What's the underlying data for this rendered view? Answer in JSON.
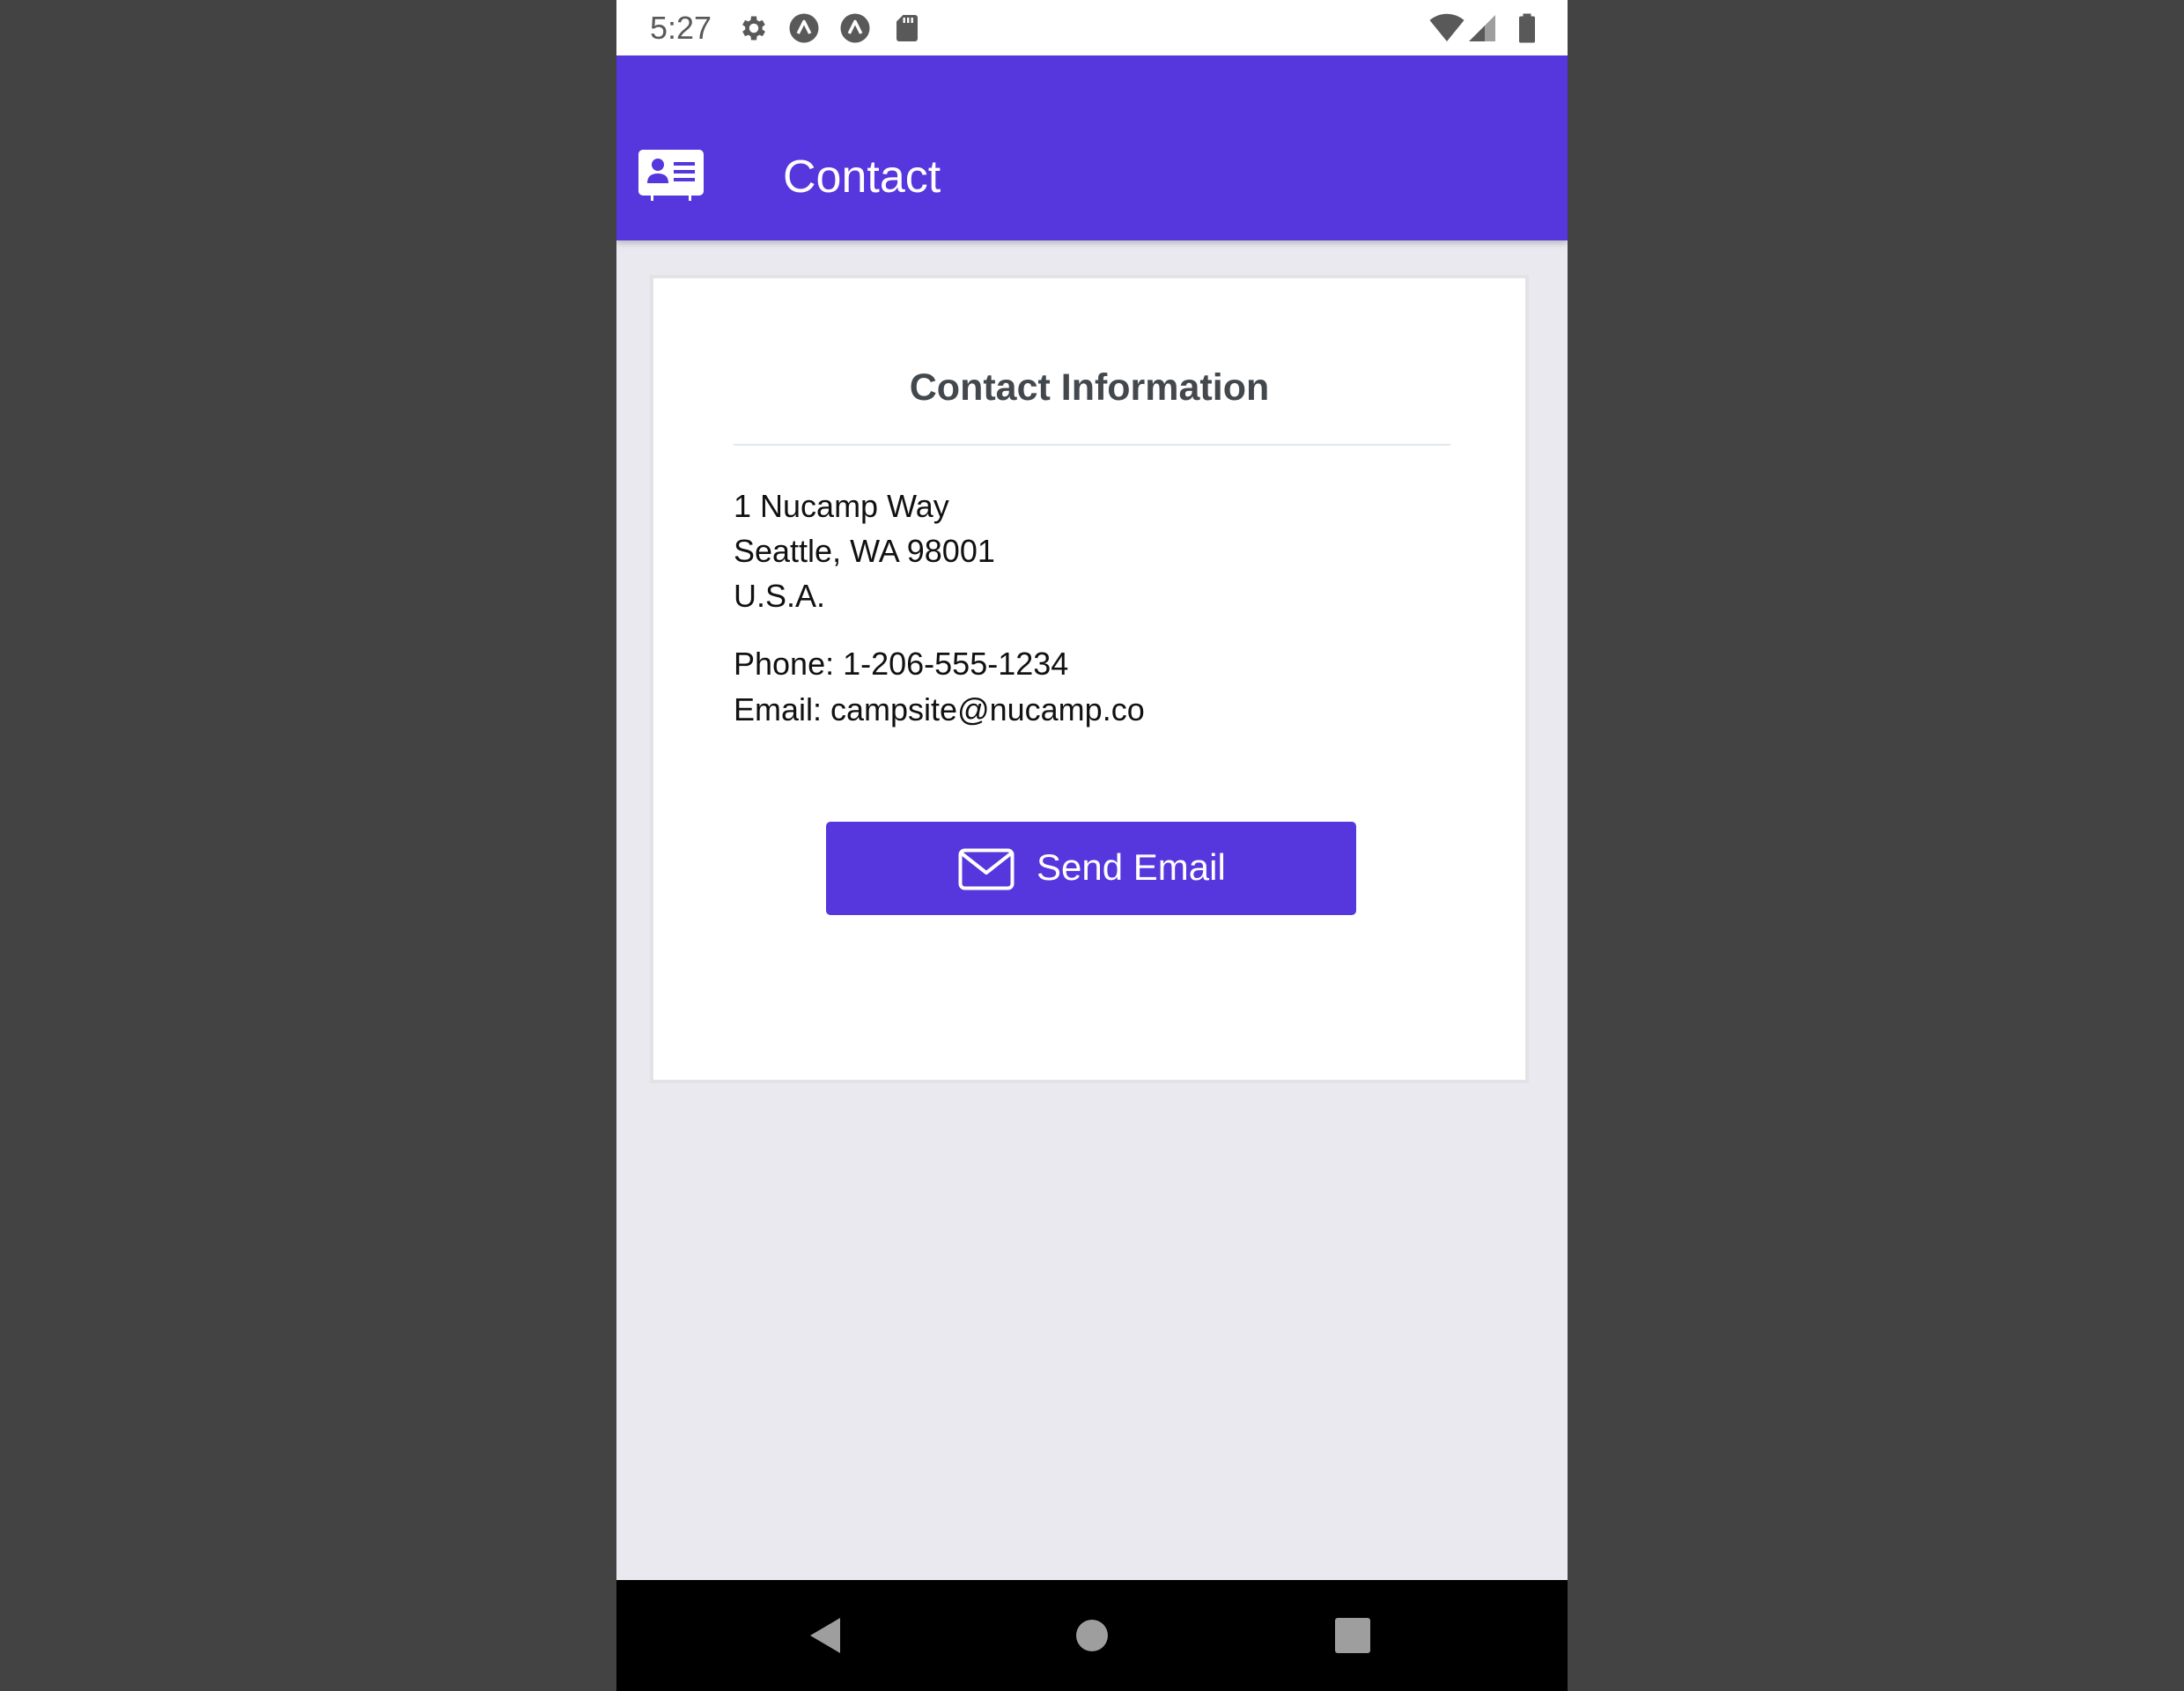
{
  "status_bar": {
    "time": "5:27",
    "icons_left": [
      "settings-icon",
      "app-notification-icon",
      "app-notification-icon",
      "sd-card-icon"
    ],
    "icons_right": [
      "wifi-icon",
      "signal-icon",
      "battery-icon"
    ]
  },
  "app_bar": {
    "icon": "contact-card-icon",
    "title": "Contact",
    "color": "#5637dd"
  },
  "card": {
    "title": "Contact Information",
    "address": {
      "line1": "1 Nucamp Way",
      "line2": "Seattle, WA 98001",
      "line3": "U.S.A."
    },
    "phone": "Phone: 1-206-555-1234",
    "email": "Email: campsite@nucamp.co",
    "button": {
      "icon": "envelope-icon",
      "label": "Send Email",
      "color": "#5637dd"
    }
  },
  "nav_bar": {
    "buttons": [
      "back-icon",
      "home-icon",
      "recents-icon"
    ]
  }
}
